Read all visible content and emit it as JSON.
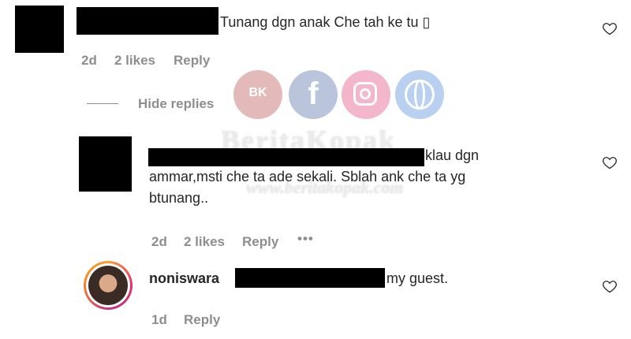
{
  "comment1": {
    "text": "Tunang dgn anak Che tah ke tu ▯",
    "time": "2d",
    "likes": "2 likes",
    "reply": "Reply"
  },
  "hide_replies": "Hide replies",
  "reply1": {
    "text_line1": "klau dgn",
    "text_line2": "ammar,msti che ta ade sekali. Sblah ank che ta yg",
    "text_line3": "btunang..",
    "time": "2d",
    "likes": "2 likes",
    "reply": "Reply",
    "more": "•••"
  },
  "reply2": {
    "username": "noniswara",
    "text": "my guest.",
    "time": "1d",
    "reply": "Reply"
  },
  "watermark": {
    "brand": "BeritaKopak",
    "url": "www.beritakopak.com",
    "badge": "BK",
    "icons": [
      "bk-logo-icon",
      "facebook-icon",
      "instagram-icon",
      "globe-icon"
    ],
    "colors": {
      "facebook": "#3b5998",
      "instagram": "#e1306c",
      "globe": "#3a7bd5",
      "bk": "#c0392b"
    }
  },
  "colors": {
    "text": "#262626",
    "meta": "#8e8e8e",
    "heart_stroke": "#262626"
  }
}
